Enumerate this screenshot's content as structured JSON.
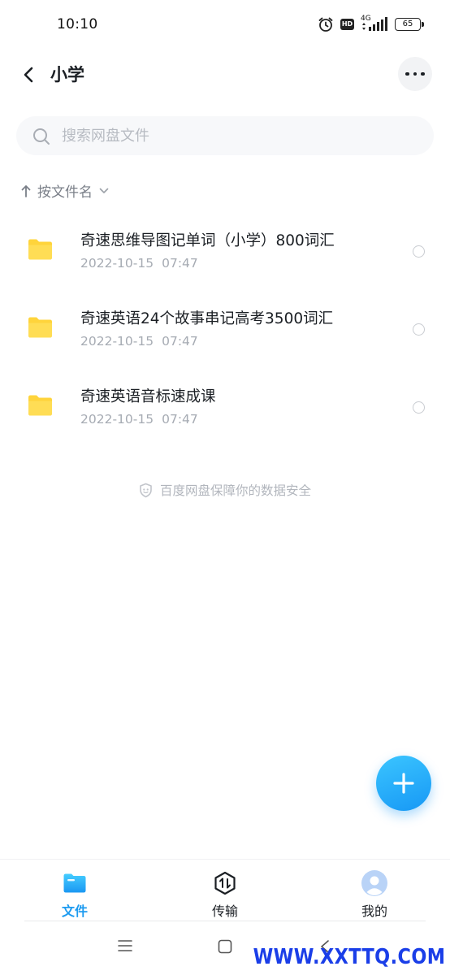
{
  "status_bar": {
    "time": "10:10",
    "network": "4G",
    "hd_badge": "HD",
    "battery": "65"
  },
  "header": {
    "title": "小学",
    "back_icon": "chevron-left-icon",
    "more_icon": "more-horizontal-icon"
  },
  "search": {
    "placeholder": "搜索网盘文件",
    "value": ""
  },
  "sort": {
    "label": "按文件名"
  },
  "files": [
    {
      "name": "奇速思维导图记单词（小学）800词汇",
      "date": "2022-10-15",
      "time": "07:47",
      "icon": "folder-icon"
    },
    {
      "name": "奇速英语24个故事串记高考3500词汇",
      "date": "2022-10-15",
      "time": "07:47",
      "icon": "folder-icon"
    },
    {
      "name": "奇速英语音标速成课",
      "date": "2022-10-15",
      "time": "07:47",
      "icon": "folder-icon"
    }
  ],
  "safety_note": "百度网盘保障你的数据安全",
  "tabs": [
    {
      "label": "文件",
      "icon": "folder-icon",
      "active": true
    },
    {
      "label": "传输",
      "icon": "transfer-icon",
      "active": false
    },
    {
      "label": "我的",
      "icon": "avatar-icon",
      "active": false
    }
  ],
  "watermark": "WWW.XXTTQ.COM",
  "colors": {
    "accent": "#1d9bf0",
    "folder": "#ffd43b",
    "watermark": "#1a3ee8"
  }
}
